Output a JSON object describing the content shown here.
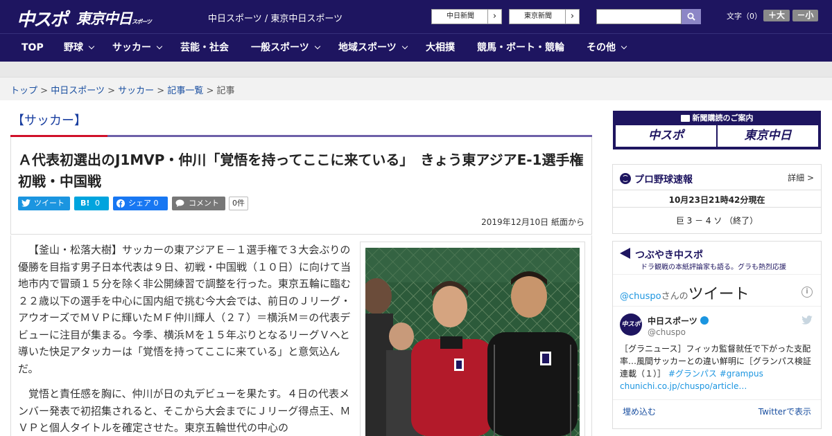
{
  "header": {
    "logo_chuspo": "中スポ",
    "logo_tokyo": "東京中日",
    "logo_tokyo_sub": "スポーツ",
    "site_links": "中日スポーツ / 東京中日スポーツ",
    "ext_links": [
      "中日新聞",
      "東京新聞"
    ],
    "search_placeholder": "",
    "font_size_label": "文字（0）",
    "font_bigger": "＋大",
    "font_smaller": "－小"
  },
  "nav": [
    {
      "label": "TOP"
    },
    {
      "label": "野球"
    },
    {
      "label": "サッカー"
    },
    {
      "label": "芸能・社会"
    },
    {
      "label": "一般スポーツ"
    },
    {
      "label": "地域スポーツ"
    },
    {
      "label": "大相撲"
    },
    {
      "label": "競馬・ボート・競輪"
    },
    {
      "label": "その他"
    }
  ],
  "breadcrumb": {
    "items": [
      "トップ",
      "中日スポーツ",
      "サッカー",
      "記事一覧"
    ],
    "separator": ">",
    "current": "記事"
  },
  "article": {
    "category": "【サッカー】",
    "headline": "Ａ代表初選出のJ1MVP・仲川「覚悟を持ってここに来ている」　きょう東アジアE-1選手権初戦・中国戦",
    "share": {
      "tweet": "ツイート",
      "hatena_count": "0",
      "facebook": "シェア 0",
      "comment": "コメント",
      "comment_count": "0件"
    },
    "dateline": "2019年12月10日 紙面から",
    "paragraphs": [
      "【釜山・松落大樹】サッカーの東アジアＥ－１選手権で３大会ぶりの優勝を目指す男子日本代表は９日、初戦・中国戦（１０日）に向けて当地市内で冒頭１５分を除く非公開練習で調整を行った。東京五輪に臨む２２歳以下の選手を中心に国内組で挑む今大会では、前日のＪリーグ・アウオーズでＭＶＰに輝いたＭＦ仲川輝人（２７）＝横浜Ｍ＝の代表デビューに注目が集まる。今季、横浜Ｍを１５年ぶりとなるリーグＶへと導いた快足アタッカーは「覚悟を持ってここに来ている」と意気込んだ。",
      "覚悟と責任感を胸に、仲川が日の丸デビューを果たす。４日の代表メンバー発表で初招集されると、そこから大会までにＪリーグ得点王、ＭＶＰと個人タイトルを確定させた。東京五輪世代の中心の"
    ]
  },
  "sidebar": {
    "subscribe": {
      "title": "新聞購読のご案内",
      "left": "中スポ",
      "right": "東京中日"
    },
    "baseball": {
      "title": "プロ野球速報",
      "detail": "詳細 >",
      "updated": "10月23日21時42分現在",
      "score": "巨 3 － 4 ソ （終了）"
    },
    "twitter": {
      "title": "つぶやき中スポ",
      "subtitle": "ドラ観戦の本紙評論家も語る。グラも熱烈応援",
      "handle_link": "@chuspo",
      "handle_suffix": "さんの",
      "tweets_label": "ツイート",
      "account_name": "中日スポーツ",
      "account_handle": "@chuspo",
      "tweet_text": "［グラニュース］フィッカ監督就任で下がった支配率…風間サッカーとの違い鮮明に［グランパス検証連載（１）］",
      "tweet_tags": "#グランパス #grampus",
      "tweet_url": "chunichi.co.jp/chuspo/article…",
      "embed": "埋め込む",
      "view_on_twitter": "Twitterで表示",
      "avatar_text": "中スポ"
    }
  },
  "colors": {
    "brand_navy": "#1e1560",
    "accent_red": "#d0102a",
    "twitter_blue": "#1b95e0"
  }
}
